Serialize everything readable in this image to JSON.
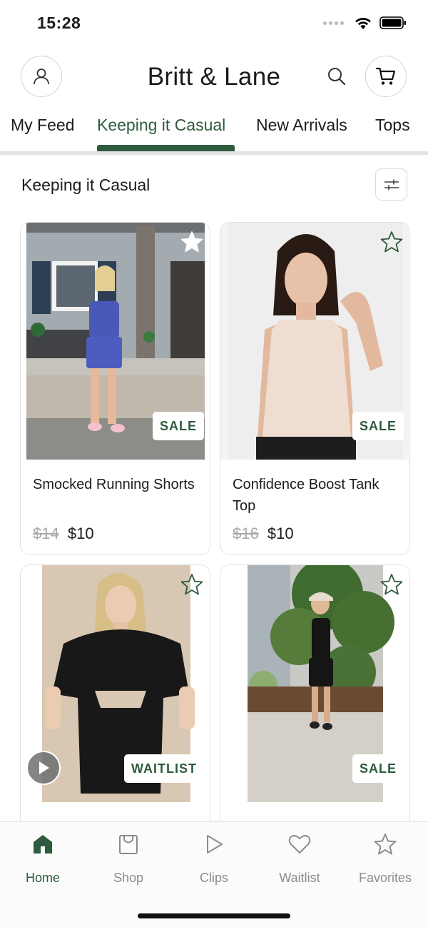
{
  "status": {
    "time": "15:28",
    "icons": [
      "cellular-dots-icon",
      "wifi-icon",
      "battery-icon"
    ]
  },
  "header": {
    "brand": "Britt & Lane",
    "icons": [
      "account-icon",
      "search-icon",
      "cart-icon"
    ]
  },
  "tabs": [
    {
      "label": "My Feed",
      "active": false
    },
    {
      "label": "Keeping it Casual",
      "active": true
    },
    {
      "label": "New Arrivals",
      "active": false
    },
    {
      "label": "Tops",
      "active": false
    }
  ],
  "section": {
    "title": "Keeping it Casual",
    "filter_icon": "sliders-icon"
  },
  "products": [
    {
      "name": "Smocked Running Shorts",
      "old_price": "$14",
      "price": "$10",
      "badge": "SALE",
      "favorited": true
    },
    {
      "name": "Confidence Boost Tank Top",
      "old_price": "$16",
      "price": "$10",
      "badge": "SALE",
      "favorited": false
    },
    {
      "badge": "WAITLIST",
      "favorited": false,
      "has_video": true
    },
    {
      "badge": "SALE",
      "favorited": false
    }
  ],
  "bottom_nav": [
    {
      "label": "Home",
      "icon": "home-icon",
      "active": true
    },
    {
      "label": "Shop",
      "icon": "shopping-bag-icon",
      "active": false
    },
    {
      "label": "Clips",
      "icon": "play-icon",
      "active": false
    },
    {
      "label": "Waitlist",
      "icon": "heart-icon",
      "active": false
    },
    {
      "label": "Favorites",
      "icon": "star-icon",
      "active": false
    }
  ],
  "colors": {
    "accent": "#2e5a3d",
    "muted_text": "#8c8c8c",
    "strike_price": "#a8a8a8"
  }
}
